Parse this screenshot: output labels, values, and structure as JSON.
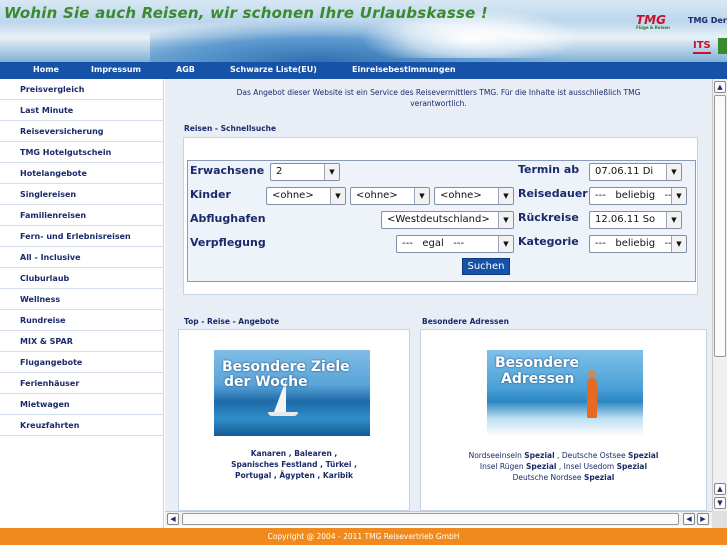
{
  "banner": {
    "slogan": "Wohin Sie auch Reisen, wir schonen Ihre Urlaubskasse !",
    "logo_tmg": "TMG",
    "logo_tmg_sub": "Flüge & Reisen",
    "tmg_der": "TMG Der",
    "logo_its": "ITS"
  },
  "nav": {
    "items": [
      "Home",
      "Impressum",
      "AGB",
      "Schwarze Liste(EU)",
      "Einreisebestimmungen"
    ]
  },
  "sidebar": {
    "items": [
      "Preisvergleich",
      "Last Minute",
      "Reiseversicherung",
      "TMG Hotelgutschein",
      "Hotelangebote",
      "Singlereisen",
      "Familienreisen",
      "Fern- und Erlebnisreisen",
      "All - Inclusive",
      "Cluburlaub",
      "Wellness",
      "Rundreise",
      "MIX & SPAR",
      "Flugangebote",
      "Ferienhäuser",
      "Mietwagen",
      "Kreuzfahrten"
    ]
  },
  "notice": {
    "line1": "Das Angebot dieser Website ist ein Service des Reisevermittlers TMG. Für die Inhalte ist ausschließlich TMG",
    "line2": "verantwortlich."
  },
  "search": {
    "title": "Reisen - Schnellsuche",
    "labels": {
      "erwachsene": "Erwachsene",
      "kinder": "Kinder",
      "abflughafen": "Abflughafen",
      "verpflegung": "Verpflegung",
      "termin": "Termin ab",
      "reisedauer": "Reisedauer",
      "rueckreise": "Rückreise",
      "kategorie": "Kategorie"
    },
    "values": {
      "erwachsene": "2",
      "kind1": "<ohne>",
      "kind2": "<ohne>",
      "kind3": "<ohne>",
      "abflughafen": "<Westdeutschland>",
      "verpflegung": "---   egal   ---",
      "termin": "07.06.11 Di",
      "reisedauer": "---   beliebig   ---",
      "rueckreise": "12.06.11 So",
      "kategorie": "---   beliebig   ---"
    },
    "button": "Suchen"
  },
  "top_angebote": {
    "title": "Top - Reise - Angebote",
    "image_caption1": "Besondere Ziele",
    "image_caption2": "der Woche",
    "line1": "Kanaren , Balearen ,",
    "line2": "Spanisches Festland , Türkei ,",
    "line3": "Portugal , Ägypten , Karibik"
  },
  "besondere": {
    "title": "Besondere Adressen",
    "image_caption1": "Besondere",
    "image_caption2": "Adressen",
    "l1a": "Nordseeinseln ",
    "l1b": "Spezial",
    "l1c": " , Deutsche Ostsee ",
    "l1d": "Spezial",
    "l2a": "Insel Rügen ",
    "l2b": "Spezial",
    "l2c": " , Insel Usedom ",
    "l2d": "Spezial",
    "l3a": "Deutsche Nordsee ",
    "l3b": "Spezial"
  },
  "footer": {
    "copyright": "Copyright @ 2004 - 2011 TMG Reisevertrieb GmbH"
  },
  "colors": {
    "nav_bg": "#1652a8",
    "footer_bg": "#f08a1c",
    "slogan": "#3a8a2e",
    "text": "#1a2a6a"
  }
}
